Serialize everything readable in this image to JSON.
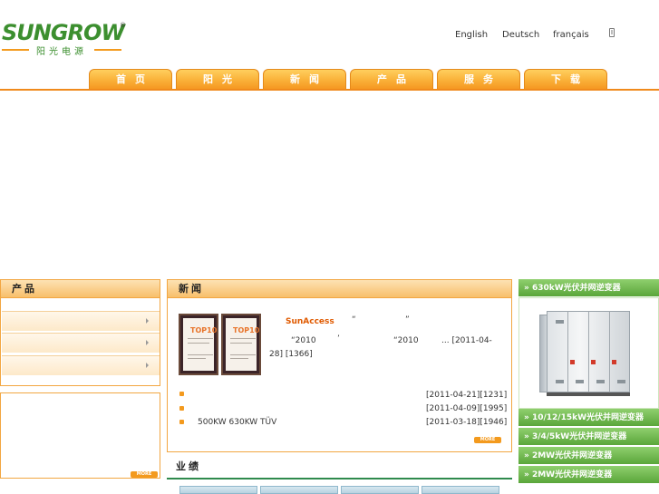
{
  "header": {
    "logo_text": "SUNGROW",
    "logo_registered": "®",
    "logo_subtitle": "阳光电源"
  },
  "languages": [
    "English",
    "Deutsch",
    "français"
  ],
  "nav": [
    "首页",
    "阳光",
    "新闻",
    "产品",
    "服务",
    "下载"
  ],
  "left": {
    "products_title": "产品",
    "more": "MORE"
  },
  "news": {
    "title": "新闻",
    "headline": "SunAccess",
    "quote_open": "“",
    "quote_close": "”",
    "line1_q1": "“2010",
    "line1_comma": "’",
    "line1_q2": "“2010",
    "line1_tail": "... [2011-04-",
    "line2": "28] [1366]",
    "cert_label": "TOP10",
    "items": [
      {
        "text": "",
        "date": "[2011-04-21][1231]"
      },
      {
        "text": "",
        "date": "[2011-04-09][1995]"
      },
      {
        "text": "500KW 630KW      TÜV",
        "date": "[2011-03-18][1946]"
      }
    ],
    "more": "MORE"
  },
  "performance": {
    "title": "业绩"
  },
  "right": {
    "items": [
      "» 630kW光伏并网逆变器",
      "» 10/12/15kW光伏并网逆变器",
      "» 3/4/5kW光伏并网逆变器",
      "» 2MW光伏并网逆变器",
      "» 2MW光伏并网逆变器"
    ]
  },
  "colors": {
    "accent_orange": "#f39a1e",
    "brand_green": "#3c8f2f",
    "right_green": "#5aa63a"
  }
}
